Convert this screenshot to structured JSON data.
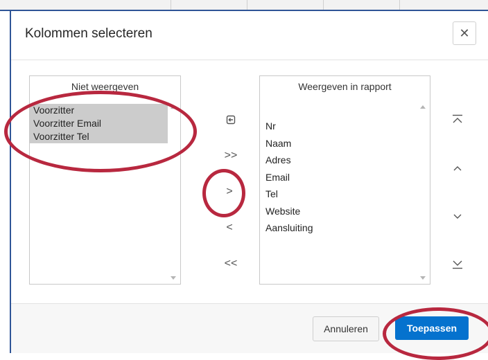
{
  "dialog": {
    "title": "Kolommen selecteren",
    "close_glyph": "✕"
  },
  "left_list": {
    "header": "Niet weergeven",
    "items": [
      "Voorzitter",
      "Voorzitter Email",
      "Voorzitter Tel"
    ]
  },
  "right_list": {
    "header": "Weergeven in rapport",
    "items": [
      "Nr",
      "Naam",
      "Adres",
      "Email",
      "Tel",
      "Website",
      "Aansluiting"
    ]
  },
  "shuttle": {
    "reset": "reset-icon",
    "move_all": ">>",
    "move": ">",
    "remove": "<",
    "remove_all": "<<"
  },
  "order": {
    "top": "move-top-icon",
    "up": "move-up-icon",
    "down": "move-down-icon",
    "bottom": "move-bottom-icon"
  },
  "footer": {
    "cancel_label": "Annuleren",
    "apply_label": "Toepassen"
  },
  "colors": {
    "accent": "#0572ce",
    "highlight_marker": "#b8283f",
    "selection": "#cccccc"
  }
}
